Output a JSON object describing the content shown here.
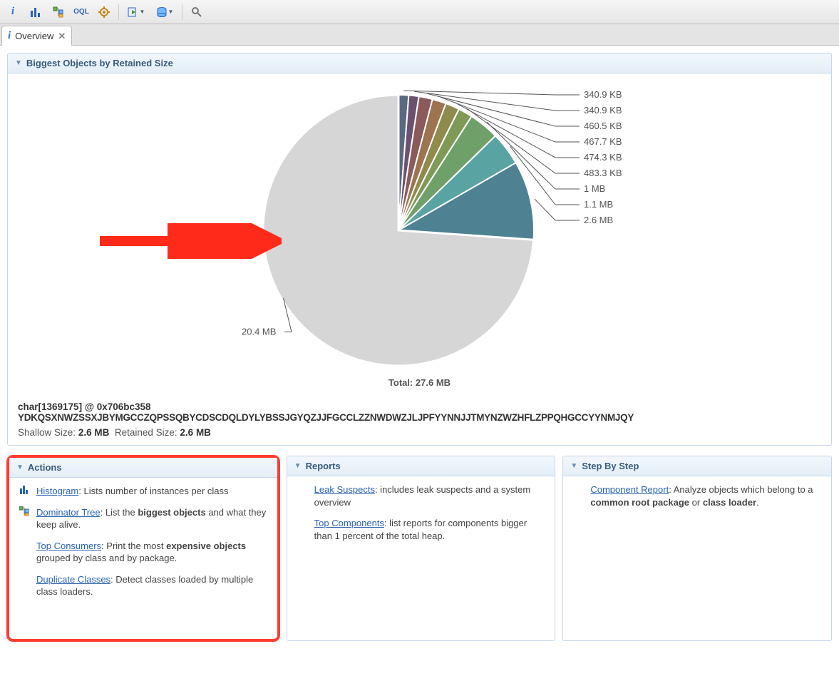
{
  "toolbar": {
    "buttons": [
      "info",
      "histogram",
      "dominator-tree",
      "oql",
      "settings",
      "run-expert",
      "query-browser",
      "search"
    ]
  },
  "tab": {
    "icon": "info",
    "title": "Overview",
    "close": "✕"
  },
  "sectionBiggest": {
    "title": "Biggest Objects by Retained Size"
  },
  "chart_data": {
    "type": "pie",
    "title": "",
    "total_label": "Total: 27.6 MB",
    "labels_outer": [
      "340.9 KB",
      "340.9 KB",
      "460.5 KB",
      "467.7 KB",
      "474.3 KB",
      "483.3 KB",
      "1 MB",
      "1.1 MB",
      "2.6 MB",
      "20.4 MB"
    ],
    "slices": [
      {
        "label": "20.4 MB",
        "value_mb": 20.4,
        "color": "#d6d6d6"
      },
      {
        "label": "2.6 MB",
        "value_mb": 2.6,
        "color": "#4e8191"
      },
      {
        "label": "1.1 MB",
        "value_mb": 1.1,
        "color": "#5aa3a3"
      },
      {
        "label": "1 MB",
        "value_mb": 1.0,
        "color": "#6fa06a"
      },
      {
        "label": "483.3 KB",
        "value_mb": 0.472,
        "color": "#7e9a56"
      },
      {
        "label": "474.3 KB",
        "value_mb": 0.463,
        "color": "#8f8a4e"
      },
      {
        "label": "467.7 KB",
        "value_mb": 0.457,
        "color": "#9d7350"
      },
      {
        "label": "460.5 KB",
        "value_mb": 0.45,
        "color": "#8c5a5a"
      },
      {
        "label": "340.9 KB",
        "value_mb": 0.333,
        "color": "#6b5170"
      },
      {
        "label": "340.9 KB",
        "value_mb": 0.333,
        "color": "#596a80"
      }
    ],
    "total_mb": 27.6
  },
  "object": {
    "line1": "char[1369175] @ 0x706bc358",
    "line2": "YDKQSXNWZSSXJBYMGCCZQPSSQBYCDSCDQLDYLYBSSJGYQZJJFGCCLZZNWDWZJLJPFYYNNJJTMYNZWZHFLZPPQHGCCYYNMJQY",
    "shallow_label": "Shallow Size:",
    "shallow_value": "2.6 MB",
    "retained_label": "Retained Size:",
    "retained_value": "2.6 MB"
  },
  "panels": {
    "actions": {
      "title": "Actions",
      "items": [
        {
          "icon": "bars",
          "link": "Histogram",
          "desc_before": "",
          "desc_after": ": Lists number of instances per class"
        },
        {
          "icon": "tree",
          "link": "Dominator Tree",
          "desc_after": ": List the ",
          "bold": "biggest objects",
          "desc_after2": " and what they keep alive."
        },
        {
          "icon": "",
          "link": "Top Consumers",
          "desc_after": ": Print the most ",
          "bold": "expensive objects",
          "desc_after2": " grouped by class and by package."
        },
        {
          "icon": "",
          "link": "Duplicate Classes",
          "desc_after": ": Detect classes loaded by multiple class loaders."
        }
      ]
    },
    "reports": {
      "title": "Reports",
      "items": [
        {
          "link": "Leak Suspects",
          "desc": ": includes leak suspects and a system overview"
        },
        {
          "link": "Top Components",
          "desc": ": list reports for components bigger than 1 percent of the total heap."
        }
      ]
    },
    "step": {
      "title": "Step By Step",
      "items": [
        {
          "link": "Component Report",
          "desc_after": ": Analyze objects which belong to a ",
          "bold": "common root package",
          "desc_after2": " or ",
          "bold2": "class loader",
          "desc_after3": "."
        }
      ]
    }
  }
}
